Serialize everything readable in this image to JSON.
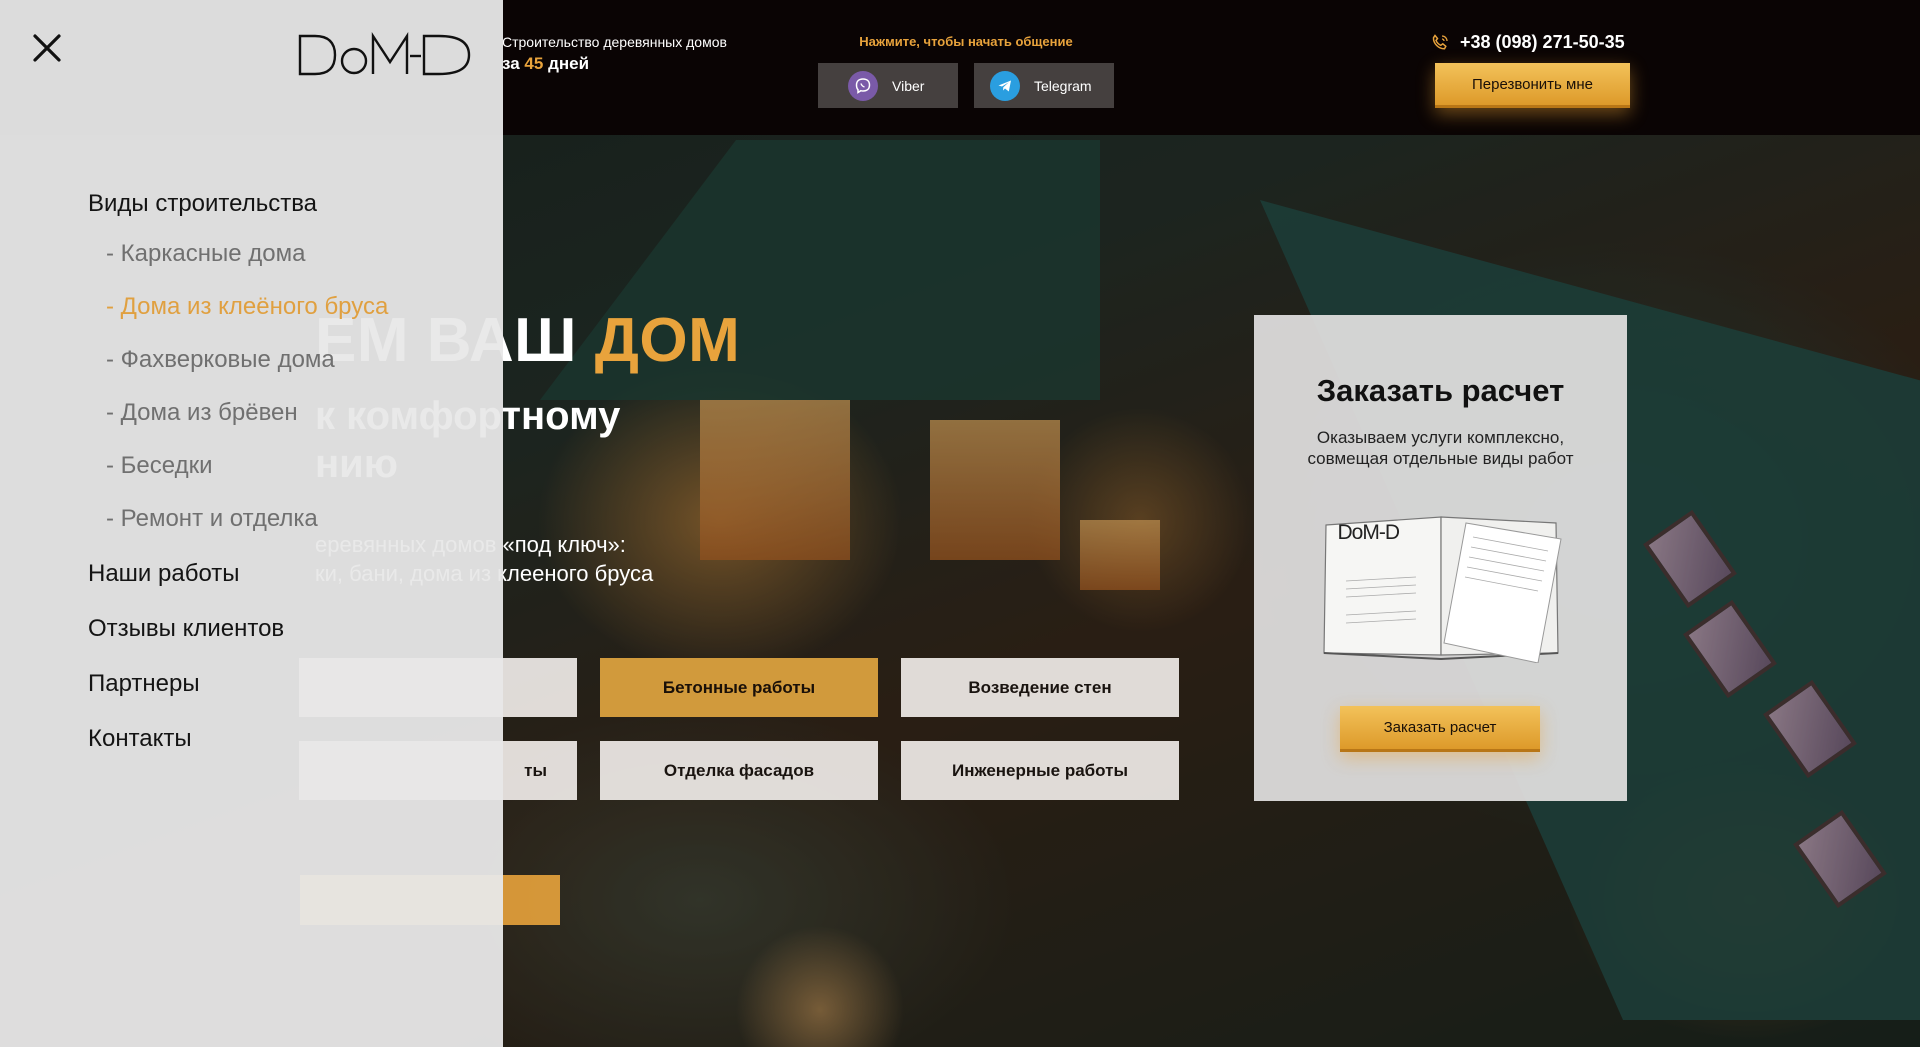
{
  "header": {
    "tagline_line1": "Строительство деревянных домов",
    "tagline_prefix": "за",
    "tagline_number": "45",
    "tagline_suffix": "дней",
    "contact_prompt": "Нажмите, чтобы начать общение",
    "viber_label": "Viber",
    "telegram_label": "Telegram",
    "phone": "+38 (098) 271-50-35",
    "callback_label": "Перезвонить мне"
  },
  "logo": {
    "text": "DoM-D"
  },
  "hero": {
    "title_partial": "ЕМ ВАШ",
    "title_accent": "ДОМ",
    "subtitle_line1": "к комфортному",
    "subtitle_line2": "нию",
    "desc_line1": "еревянных домов «под ключ»:",
    "desc_line2": "ки, бани, дома из клееного бруса"
  },
  "services": [
    {
      "label": "Бетонные работы"
    },
    {
      "label": "Возведение стен"
    },
    {
      "label": "ты"
    },
    {
      "label": "Отделка фасадов"
    },
    {
      "label": "Инженерные работы"
    }
  ],
  "order_card": {
    "title": "Заказать расчет",
    "text": "Оказываем  услуги комплексно, совмещая отдельные виды работ",
    "book_logo": "DoM-D",
    "button_label": "Заказать расчет"
  },
  "menu": {
    "section1": "Виды строительства",
    "subitems": [
      {
        "label": "- Каркасные дома"
      },
      {
        "label": "- Дома из клеёного бруса"
      },
      {
        "label": "- Фахверковые дома"
      },
      {
        "label": "- Дома из брёвен"
      },
      {
        "label": "- Беседки"
      },
      {
        "label": "- Ремонт и отделка"
      }
    ],
    "section2": "Наши работы",
    "section3": "Отзывы клиентов",
    "section4": "Партнеры",
    "section5": "Контакты"
  },
  "colors": {
    "accent": "#e8a33c",
    "menu_active": "#e0a040",
    "topbar": "#0a0404"
  }
}
